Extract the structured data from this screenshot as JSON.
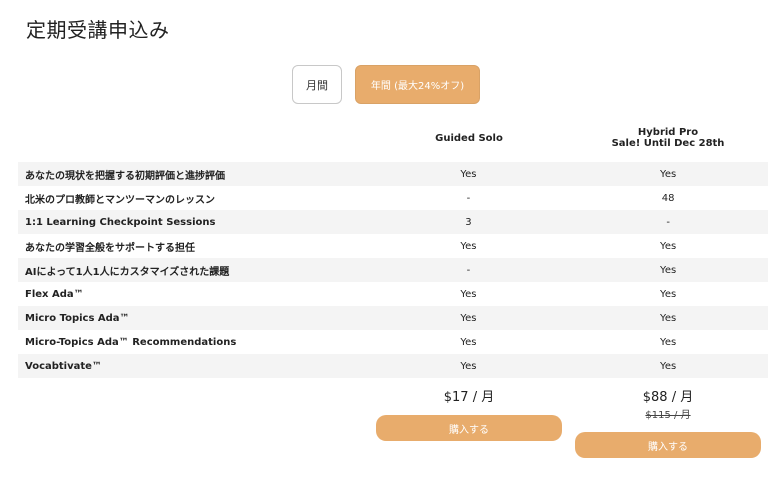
{
  "page": {
    "title": "定期受講申込み"
  },
  "billing_toggle": {
    "monthly_label": "月間",
    "yearly_label": "年間 (最大24%オフ)",
    "selected": "yearly"
  },
  "plans": {
    "solo": {
      "name": "Guided Solo",
      "price": "$17 / 月",
      "buy_label": "購入する"
    },
    "hybrid": {
      "name": "Hybrid Pro",
      "sale": "Sale! Until Dec 28th",
      "price": "$88 / 月",
      "old_price": "$115 / 月",
      "buy_label": "購入する"
    }
  },
  "features": [
    {
      "name": "あなたの現状を把握する初期評価と進捗評価",
      "solo": "Yes",
      "hybrid": "Yes"
    },
    {
      "name": "北米のプロ教師とマンツーマンのレッスン",
      "solo": "-",
      "hybrid": "48"
    },
    {
      "name": "1:1 Learning Checkpoint Sessions",
      "solo": "3",
      "hybrid": "-"
    },
    {
      "name": "あなたの学習全般をサポートする担任",
      "solo": "Yes",
      "hybrid": "Yes"
    },
    {
      "name": "AIによって1人1人にカスタマイズされた課題",
      "solo": "-",
      "hybrid": "Yes"
    },
    {
      "name": "Flex Ada™",
      "solo": "Yes",
      "hybrid": "Yes"
    },
    {
      "name": "Micro Topics Ada™",
      "solo": "Yes",
      "hybrid": "Yes"
    },
    {
      "name": "Micro-Topics Ada™ Recommendations",
      "solo": "Yes",
      "hybrid": "Yes"
    },
    {
      "name": "Vocabtivate™",
      "solo": "Yes",
      "hybrid": "Yes"
    }
  ],
  "colors": {
    "accent": "#e8ac6c",
    "row_shade": "#f4f4f4",
    "border": "#c8c8c8"
  }
}
